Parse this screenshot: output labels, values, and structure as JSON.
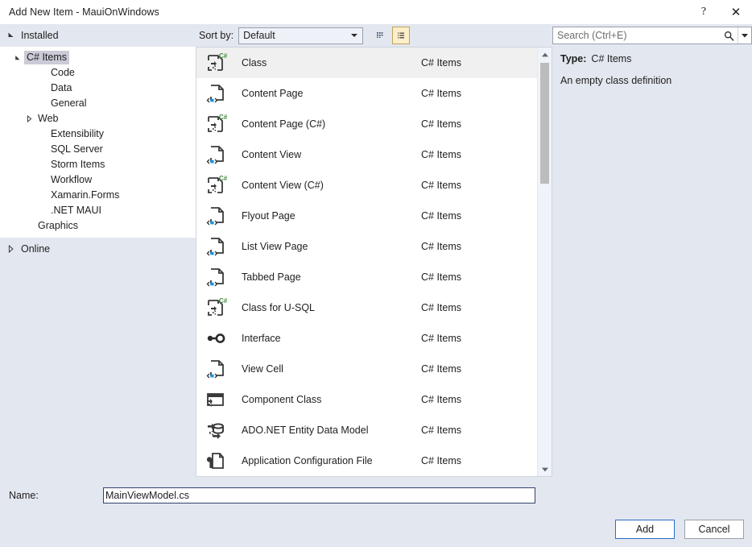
{
  "window": {
    "title": "Add New Item - MauiOnWindows",
    "help_label": "?",
    "close_label": "✕"
  },
  "toolbar": {
    "installed_label": "Installed",
    "sort_by_label": "Sort by:",
    "sort_by_value": "Default",
    "view_tiles_name": "medium-icons-view",
    "view_list_name": "list-view",
    "search_placeholder": "Search (Ctrl+E)",
    "search_value": ""
  },
  "tree": {
    "root": "C# Items",
    "items": [
      {
        "label": "C# Items",
        "indent": 1,
        "twisty": "down",
        "selected": true
      },
      {
        "label": "Code",
        "indent": 3,
        "twisty": "none",
        "selected": false
      },
      {
        "label": "Data",
        "indent": 3,
        "twisty": "none",
        "selected": false
      },
      {
        "label": "General",
        "indent": 3,
        "twisty": "none",
        "selected": false
      },
      {
        "label": "Web",
        "indent": 2,
        "twisty": "right",
        "selected": false
      },
      {
        "label": "Extensibility",
        "indent": 3,
        "twisty": "none",
        "selected": false
      },
      {
        "label": "SQL Server",
        "indent": 3,
        "twisty": "none",
        "selected": false
      },
      {
        "label": "Storm Items",
        "indent": 3,
        "twisty": "none",
        "selected": false
      },
      {
        "label": "Workflow",
        "indent": 3,
        "twisty": "none",
        "selected": false
      },
      {
        "label": "Xamarin.Forms",
        "indent": 3,
        "twisty": "none",
        "selected": false
      },
      {
        "label": ".NET MAUI",
        "indent": 3,
        "twisty": "none",
        "selected": false
      },
      {
        "label": "Graphics",
        "indent": 2,
        "twisty": "none",
        "selected": false
      }
    ],
    "online_label": "Online"
  },
  "list": {
    "category_all": "C# Items",
    "items": [
      {
        "name": "Class",
        "category": "C# Items",
        "icon": "csharp-class-icon",
        "selected": true
      },
      {
        "name": "Content Page",
        "category": "C# Items",
        "icon": "xaml-page-icon",
        "selected": false
      },
      {
        "name": "Content Page (C#)",
        "category": "C# Items",
        "icon": "csharp-class-icon",
        "selected": false
      },
      {
        "name": "Content View",
        "category": "C# Items",
        "icon": "xaml-page-icon",
        "selected": false
      },
      {
        "name": "Content View (C#)",
        "category": "C# Items",
        "icon": "csharp-class-icon",
        "selected": false
      },
      {
        "name": "Flyout Page",
        "category": "C# Items",
        "icon": "xaml-page-icon",
        "selected": false
      },
      {
        "name": "List View Page",
        "category": "C# Items",
        "icon": "xaml-page-icon",
        "selected": false
      },
      {
        "name": "Tabbed Page",
        "category": "C# Items",
        "icon": "xaml-page-icon",
        "selected": false
      },
      {
        "name": "Class for U-SQL",
        "category": "C# Items",
        "icon": "csharp-class-icon",
        "selected": false
      },
      {
        "name": "Interface",
        "category": "C# Items",
        "icon": "interface-icon",
        "selected": false
      },
      {
        "name": "View Cell",
        "category": "C# Items",
        "icon": "xaml-page-icon",
        "selected": false
      },
      {
        "name": "Component Class",
        "category": "C# Items",
        "icon": "component-class-icon",
        "selected": false
      },
      {
        "name": "ADO.NET Entity Data Model",
        "category": "C# Items",
        "icon": "entity-data-model-icon",
        "selected": false
      },
      {
        "name": "Application Configuration File",
        "category": "C# Items",
        "icon": "config-file-icon",
        "selected": false
      }
    ]
  },
  "details": {
    "type_label": "Type:",
    "type_value": "C# Items",
    "description": "An empty class definition"
  },
  "footer": {
    "name_label": "Name:",
    "name_value": "MainViewModel.cs",
    "add_label": "Add",
    "cancel_label": "Cancel"
  },
  "colors": {
    "dialog_bg": "#e3e7ef",
    "panel_bg": "#ffffff",
    "selection": "#f0f0f0",
    "tree_selection": "#cbcbd8",
    "accent_blue": "#2a6fc9",
    "toggle_selected": "#fdeeca",
    "csharp_green": "#3f8a3f",
    "xaml_blue": "#0097e6"
  }
}
